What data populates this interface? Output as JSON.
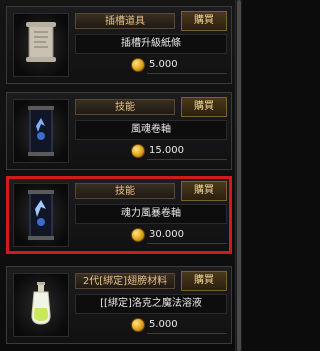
{
  "cards": [
    {
      "category": "插槽道具",
      "buy_label": "購買",
      "name": "插槽升級紙條",
      "price": "5.000",
      "icon": "paper-scroll-icon"
    },
    {
      "category": "技能",
      "buy_label": "購買",
      "name": "風魂卷軸",
      "price": "15.000",
      "icon": "skill-scroll-icon"
    },
    {
      "category": "技能",
      "buy_label": "購買",
      "name": "魂力風暴卷軸",
      "price": "30.000",
      "icon": "skill-scroll-icon",
      "selected": true
    },
    {
      "category": "2代[綁定]翅膀材料",
      "buy_label": "購買",
      "name": "[[綁定]洛克之魔法溶液",
      "price": "5.000",
      "icon": "potion-bottle-icon"
    }
  ],
  "colors": {
    "selection": "#d11a1a",
    "accent": "#e6c18b",
    "coin": "#e0a41a"
  }
}
